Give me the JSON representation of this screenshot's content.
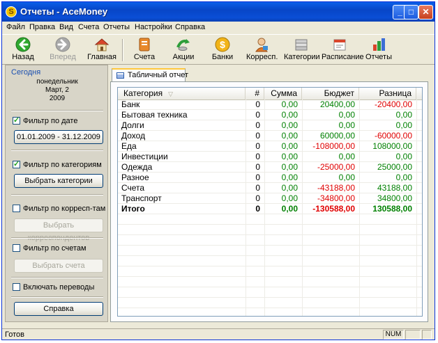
{
  "window": {
    "title": "Отчеты - AceMoney",
    "app_icon_glyph": "S",
    "controls": {
      "minimize": "_",
      "maximize": "□",
      "close": "✕"
    }
  },
  "menu": [
    "Файл",
    "Правка",
    "Вид",
    "Счета",
    "Отчеты",
    "Настройки",
    "Справка"
  ],
  "toolbar": [
    {
      "label": "Назад",
      "icon": "back-arrow-icon",
      "enabled": true
    },
    {
      "label": "Вперед",
      "icon": "forward-arrow-icon",
      "enabled": false
    },
    {
      "label": "Главная",
      "icon": "home-icon",
      "enabled": true
    },
    {
      "label": "Счета",
      "icon": "accounts-icon",
      "enabled": true
    },
    {
      "label": "Акции",
      "icon": "stocks-icon",
      "enabled": true
    },
    {
      "label": "Банки",
      "icon": "banks-icon",
      "enabled": true
    },
    {
      "label": "Корресп.",
      "icon": "payees-icon",
      "enabled": true
    },
    {
      "label": "Категории",
      "icon": "categories-icon",
      "enabled": true
    },
    {
      "label": "Расписание",
      "icon": "schedule-icon",
      "enabled": true
    },
    {
      "label": "Отчеты",
      "icon": "reports-icon",
      "enabled": true
    }
  ],
  "today": {
    "title": "Сегодня",
    "weekday": "понедельник",
    "date": "Март, 2",
    "year": "2009"
  },
  "filters": {
    "date_filter": {
      "label": "Фильтр по дате",
      "checked": true,
      "button": "01.01.2009 - 31.12.2009"
    },
    "category_filter": {
      "label": "Фильтр по категориям",
      "checked": true,
      "button": "Выбрать категории"
    },
    "payee_filter": {
      "label": "Фильтр по корресп-там",
      "checked": false,
      "button": "Выбрать корреспондентов"
    },
    "account_filter": {
      "label": "Фильтр по счетам",
      "checked": false,
      "button": "Выбрать счета"
    },
    "include_transfers": {
      "label": "Включать переводы",
      "checked": false
    },
    "help_button": "Справка"
  },
  "tab": {
    "label": "Табличный отчет"
  },
  "table": {
    "columns": [
      "Категория",
      "#",
      "Сумма",
      "Бюджет",
      "Разница"
    ],
    "rows": [
      {
        "category": "Банк",
        "count": "0",
        "sum": "0,00",
        "budget": "20400,00",
        "diff": "-20400,00"
      },
      {
        "category": "Бытовая техника",
        "count": "0",
        "sum": "0,00",
        "budget": "0,00",
        "diff": "0,00"
      },
      {
        "category": "Долги",
        "count": "0",
        "sum": "0,00",
        "budget": "0,00",
        "diff": "0,00"
      },
      {
        "category": "Доход",
        "count": "0",
        "sum": "0,00",
        "budget": "60000,00",
        "diff": "-60000,00"
      },
      {
        "category": "Еда",
        "count": "0",
        "sum": "0,00",
        "budget": "-108000,00",
        "diff": "108000,00"
      },
      {
        "category": "Инвестиции",
        "count": "0",
        "sum": "0,00",
        "budget": "0,00",
        "diff": "0,00"
      },
      {
        "category": "Одежда",
        "count": "0",
        "sum": "0,00",
        "budget": "-25000,00",
        "diff": "25000,00"
      },
      {
        "category": "Разное",
        "count": "0",
        "sum": "0,00",
        "budget": "0,00",
        "diff": "0,00"
      },
      {
        "category": "Счета",
        "count": "0",
        "sum": "0,00",
        "budget": "-43188,00",
        "diff": "43188,00"
      },
      {
        "category": "Транспорт",
        "count": "0",
        "sum": "0,00",
        "budget": "-34800,00",
        "diff": "34800,00"
      }
    ],
    "total": {
      "category": "Итого",
      "count": "0",
      "sum": "0,00",
      "budget": "-130588,00",
      "diff": "130588,00"
    }
  },
  "status": {
    "text": "Готов",
    "num": "NUM"
  },
  "colors": {
    "positive": "#008000",
    "negative": "#E00000",
    "title_bar": "#0A4ED6",
    "accent_link": "#1A4FB0"
  }
}
